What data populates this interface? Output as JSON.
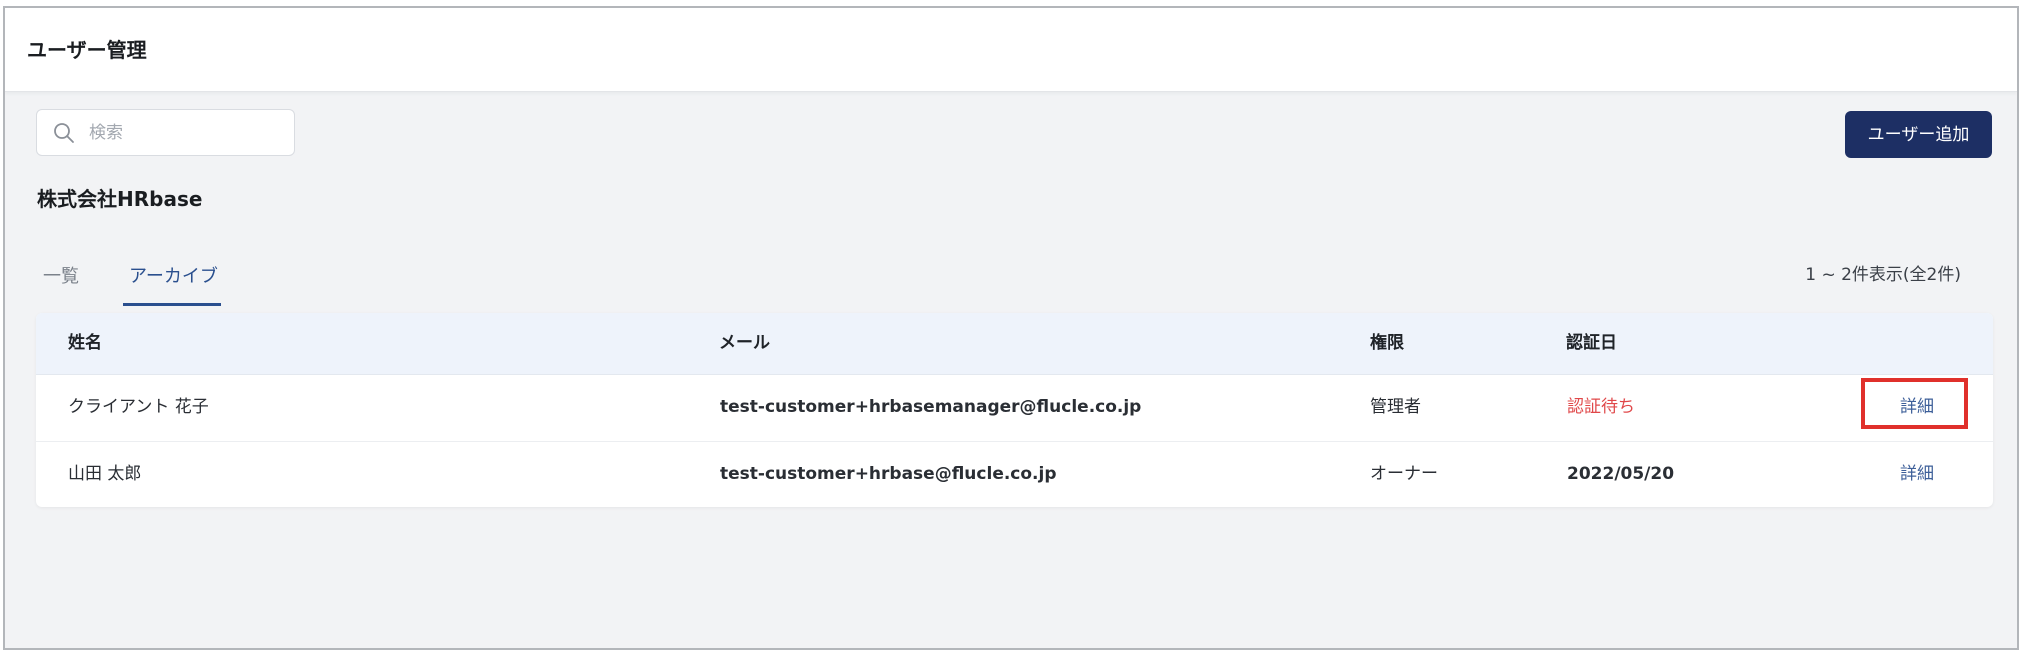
{
  "header": {
    "title": "ユーザー管理"
  },
  "search": {
    "placeholder": "検索",
    "icon": "search-icon"
  },
  "toolbar": {
    "add_user_label": "ユーザー追加",
    "accent": "#1d2f64"
  },
  "company": {
    "name": "株式会社HRbase"
  },
  "tabs": [
    {
      "label": "一覧",
      "active": false
    },
    {
      "label": "アーカイブ",
      "active": true
    }
  ],
  "pagination": {
    "summary": "1 ~ 2件表示(全2件)"
  },
  "table": {
    "headers": [
      "姓名",
      "メール",
      "権限",
      "認証日"
    ],
    "rows": [
      {
        "name": "クライアント 花子",
        "email": "test-customer+hrbasemanager@flucle.co.jp",
        "role": "管理者",
        "auth_date": "認証待ち",
        "action": "詳細",
        "status_color": "#e0484a"
      },
      {
        "name": "山田 太郎",
        "email": "test-customer+hrbase@flucle.co.jp",
        "role": "オーナー",
        "auth_date": "2022/05/20",
        "action": "詳細"
      }
    ]
  }
}
